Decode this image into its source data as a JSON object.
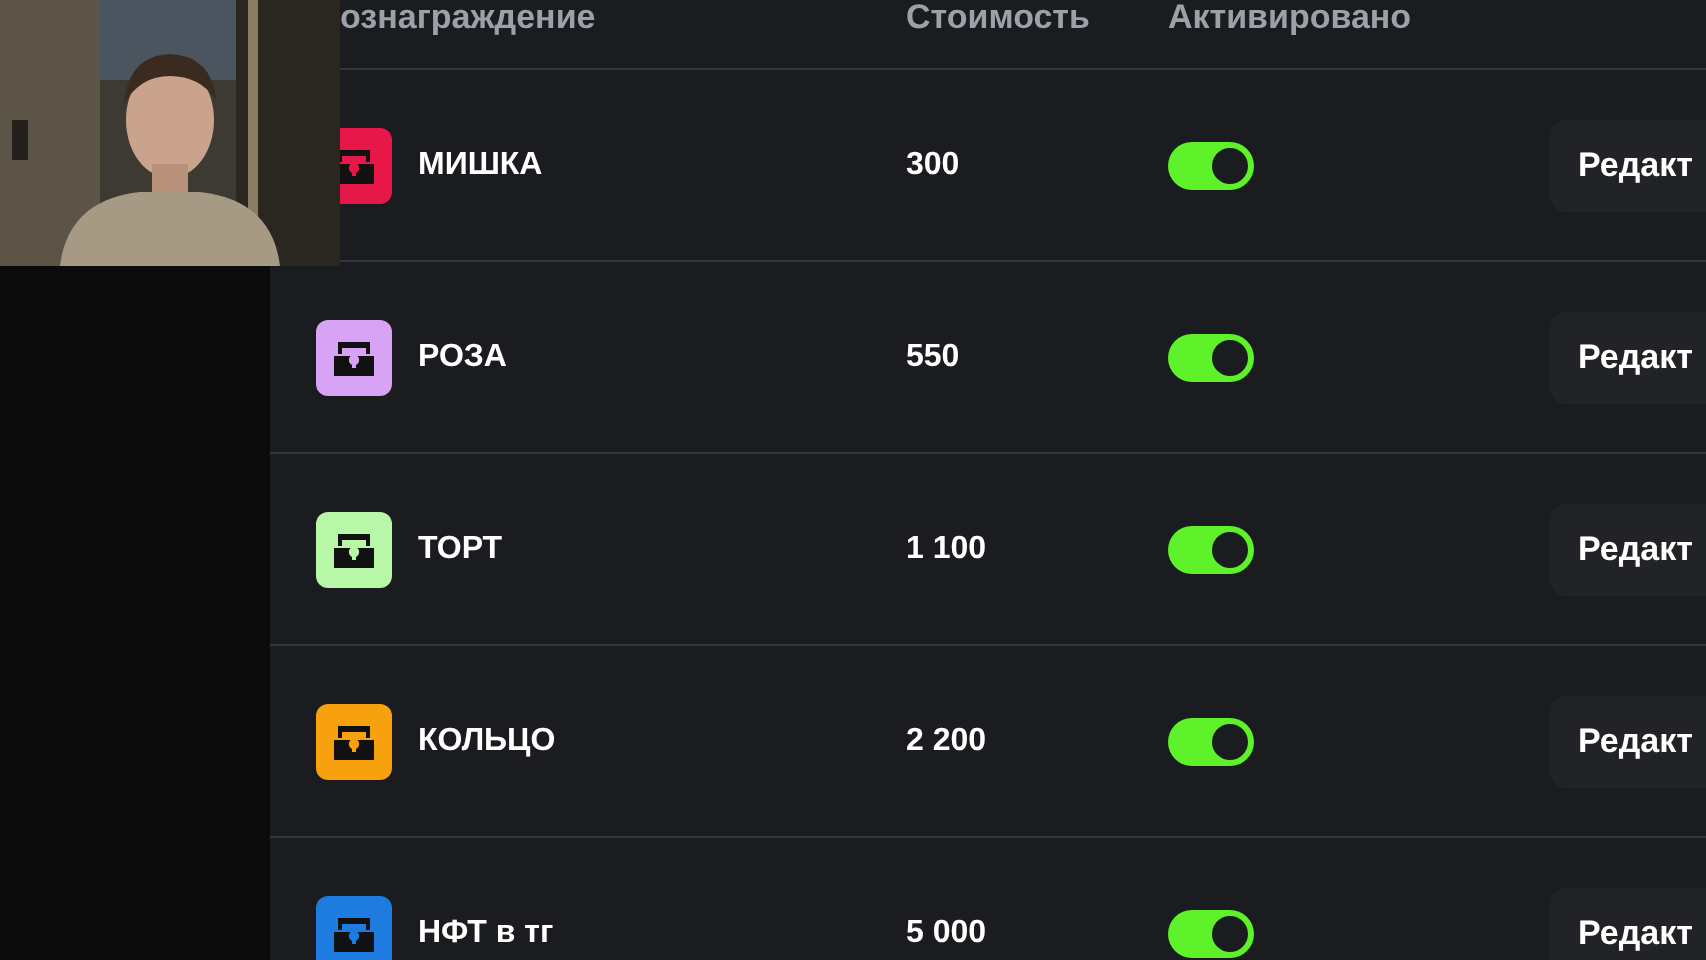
{
  "table": {
    "columns": [
      "ознаграждение",
      "Стоимость",
      "Активировано"
    ],
    "rows": [
      {
        "name": "МИШКА",
        "cost": "300",
        "active": true,
        "color": "#e8174a",
        "action": "Редакт"
      },
      {
        "name": "РОЗА",
        "cost": "550",
        "active": true,
        "color": "#d9a3f5",
        "action": "Редакт"
      },
      {
        "name": "ТОРТ",
        "cost": "1 100",
        "active": true,
        "color": "#b9f7a8",
        "action": "Редакт"
      },
      {
        "name": "КОЛЬЦО",
        "cost": "2 200",
        "active": true,
        "color": "#f8a10f",
        "action": "Редакт"
      },
      {
        "name": "НФТ в тг",
        "cost": "5 000",
        "active": true,
        "color": "#1e7be0",
        "action": "Редакт"
      }
    ]
  }
}
